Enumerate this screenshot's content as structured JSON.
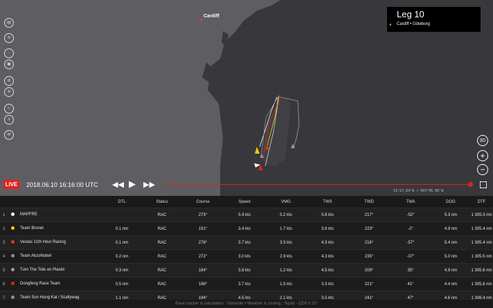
{
  "map": {
    "city": "Cardiff",
    "leg_title": "Leg 10",
    "leg_route": "Cardiff • Göteborg",
    "leg_back": "◂",
    "left_controls": [
      "layers-icon",
      "compass-icon",
      "globe-icon",
      "camera-icon",
      "satellite-icon",
      "weather-icon",
      "grid-icon",
      "list-icon",
      "mail-icon"
    ],
    "right_controls": {
      "view3d": "3D",
      "zoom_in": "+",
      "zoom_out": "−"
    },
    "coordinates": "51°27.64'N • 003°06.86'W"
  },
  "playback": {
    "live_label": "LIVE",
    "datetime": "2018.06.10 16:16:00 UTC",
    "rewind": "◀◀",
    "play": "▶",
    "forward": "▶▶"
  },
  "table": {
    "headers": [
      "",
      "",
      "DTL",
      "Status",
      "Course",
      "Speed",
      "VMG",
      "TWS",
      "TWD",
      "TWA",
      "DOG",
      "DTF"
    ],
    "rows": [
      {
        "pos": "1",
        "color": "#ffffff",
        "team": "MAPFRE",
        "dtl": "",
        "status": "RAC",
        "course": "273°",
        "speed": "5.4 kts",
        "vmg": "5.2 kts",
        "tws": "5.8 kts",
        "twd": "217°",
        "twa": "-52°",
        "dog": "5.3 nm",
        "dtf": "1 305.3 nm"
      },
      {
        "pos": "2",
        "color": "#f5d000",
        "team": "Team Brunel",
        "dtl": "0.1 nm",
        "status": "RAC",
        "course": "191°",
        "speed": "3.4 kts",
        "vmg": "1.7 kts",
        "tws": "3.8 kts",
        "twd": "223°",
        "twa": "-2°",
        "dog": "4.9 nm",
        "dtf": "1 305.4 nm"
      },
      {
        "pos": "3",
        "color": "#e0382c",
        "team": "Vestas 11th Hour Racing",
        "dtl": "0.1 nm",
        "status": "RAC",
        "course": "278°",
        "speed": "3.7 kts",
        "vmg": "3.5 kts",
        "tws": "4.3 kts",
        "twd": "216°",
        "twa": "-57°",
        "dog": "5.4 nm",
        "dtf": "1 305.4 nm"
      },
      {
        "pos": "4",
        "color": "#8a8fa8",
        "team": "Team AkzoNobel",
        "dtl": "0.2 nm",
        "status": "RAC",
        "course": "272°",
        "speed": "3.0 kts",
        "vmg": "2.9 kts",
        "tws": "4.3 kts",
        "twd": "235°",
        "twa": "-37°",
        "dog": "5.0 nm",
        "dtf": "1 305.5 nm"
      },
      {
        "pos": "5",
        "color": "#9aa0a6",
        "team": "Turn The Tide on Plastic",
        "dtl": "0.3 nm",
        "status": "RAC",
        "course": "184°",
        "speed": "3.8 kts",
        "vmg": "1.2 kts",
        "tws": "4.5 kts",
        "twd": "209°",
        "twa": "35°",
        "dog": "4.9 nm",
        "dtf": "1 305.6 nm"
      },
      {
        "pos": "6",
        "color": "#e0221a",
        "team": "Dongfeng Race Team",
        "dtl": "0.5 nm",
        "status": "RAC",
        "course": "186°",
        "speed": "3.7 kts",
        "vmg": "1.5 kts",
        "tws": "3.3 kts",
        "twd": "221°",
        "twa": "41°",
        "dog": "4.4 nm",
        "dtf": "1 305.8 nm"
      },
      {
        "pos": "7",
        "color": "#8a8fa8",
        "team": "Team Sun Hung Kai / Scallywag",
        "dtl": "1.1 nm",
        "status": "RAC",
        "course": "194°",
        "speed": "4.5 kts",
        "vmg": "2.1 kts",
        "tws": "3.5 kts",
        "twd": "241°",
        "twa": "47°",
        "dog": "4.6 nm",
        "dtf": "1 306.4 nm"
      }
    ]
  },
  "footer": "Race tracker & calculation : Géovoile • Weather & routing : Squid - CEP 0.25°"
}
